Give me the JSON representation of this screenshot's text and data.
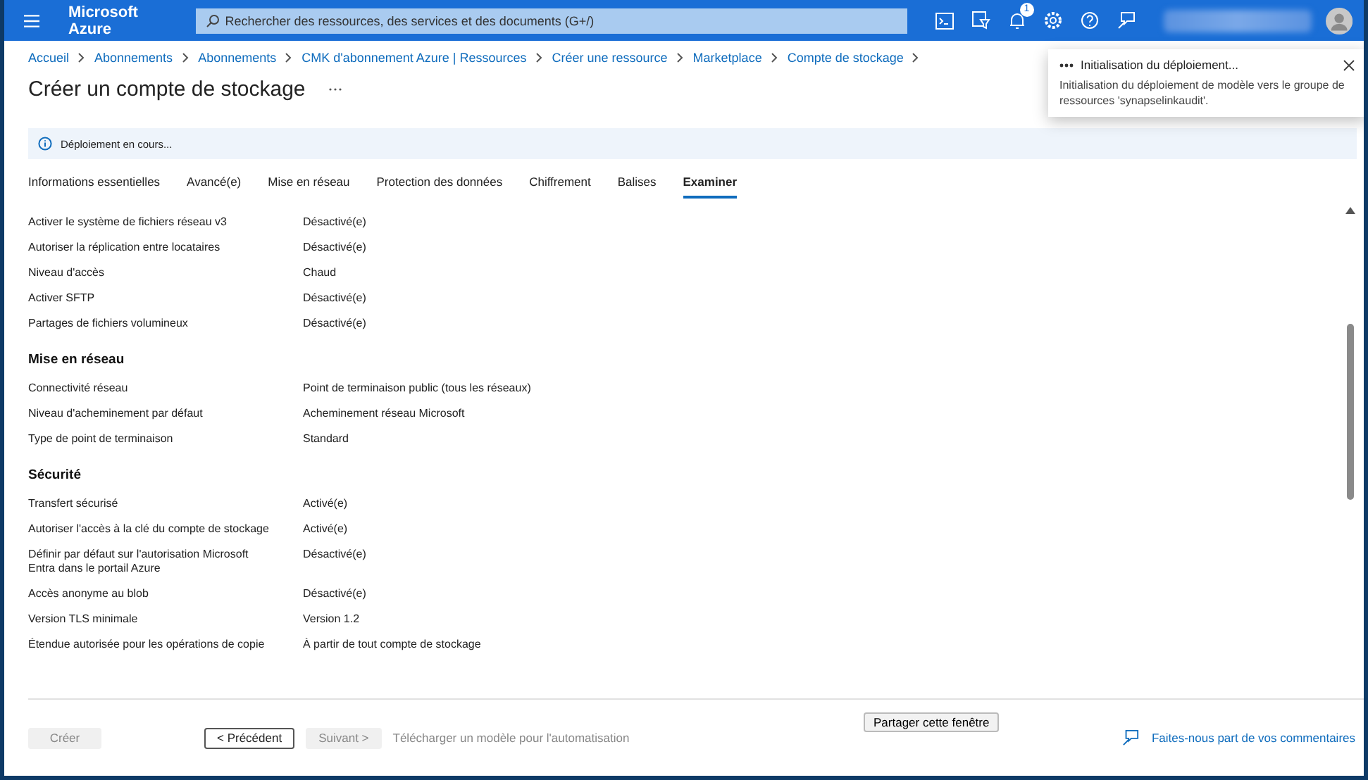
{
  "topbar": {
    "brand": "Microsoft Azure",
    "search": {
      "placeholder": "Rechercher des ressources, des services et des documents (G+/)"
    },
    "notification_count": "1"
  },
  "breadcrumb": [
    "Accueil",
    "Abonnements",
    "Abonnements",
    "CMK d'abonnement Azure | Ressources",
    "Créer une ressource",
    "Marketplace",
    "Compte de stockage"
  ],
  "page": {
    "title": "Créer un compte de stockage"
  },
  "banner": {
    "text": "Déploiement en cours..."
  },
  "tabs": [
    {
      "label": "Informations essentielles",
      "selected": false
    },
    {
      "label": "Avancé(e)",
      "selected": false
    },
    {
      "label": "Mise en réseau",
      "selected": false
    },
    {
      "label": "Protection des données",
      "selected": false
    },
    {
      "label": "Chiffrement",
      "selected": false
    },
    {
      "label": "Balises",
      "selected": false
    },
    {
      "label": "Examiner",
      "selected": true
    }
  ],
  "sections": [
    {
      "rows": [
        {
          "label": "Activer le système de fichiers réseau v3",
          "value": "Désactivé(e)"
        },
        {
          "label": "Autoriser la réplication entre locataires",
          "value": "Désactivé(e)"
        },
        {
          "label": "Niveau d'accès",
          "value": "Chaud"
        },
        {
          "label": "Activer SFTP",
          "value": "Désactivé(e)"
        },
        {
          "label": "Partages de fichiers volumineux",
          "value": "Désactivé(e)"
        }
      ]
    },
    {
      "heading": "Mise en réseau",
      "rows": [
        {
          "label": "Connectivité réseau",
          "value": "Point de terminaison public (tous les réseaux)"
        },
        {
          "label": "Niveau d'acheminement par défaut",
          "value": "Acheminement réseau Microsoft"
        },
        {
          "label": "Type de point de terminaison",
          "value": "Standard"
        }
      ]
    },
    {
      "heading": "Sécurité",
      "rows": [
        {
          "label": "Transfert sécurisé",
          "value": "Activé(e)"
        },
        {
          "label": "Autoriser l'accès à la clé du compte de stockage",
          "value": "Activé(e)"
        },
        {
          "label": "Définir par défaut sur l'autorisation Microsoft Entra dans le portail Azure",
          "value": "Désactivé(e)"
        },
        {
          "label": "Accès anonyme au blob",
          "value": "Désactivé(e)"
        },
        {
          "label": "Version TLS minimale",
          "value": "Version 1.2"
        },
        {
          "label": "Étendue autorisée pour les opérations de copie",
          "value": "À partir de tout compte de stockage"
        }
      ]
    }
  ],
  "footer": {
    "buttons": [
      {
        "kind": "button",
        "label": "Créer",
        "disabled": true
      },
      {
        "kind": "button",
        "label": "< Précédent",
        "disabled": false
      },
      {
        "kind": "button",
        "label": "Suivant >",
        "disabled": true
      },
      {
        "kind": "link",
        "label": "Télécharger un modèle pour l'automatisation",
        "disabled": true
      }
    ],
    "share_button": "Partager cette fenêtre",
    "feedback": "Faites-nous part de vos commentaires"
  },
  "toast": {
    "title": "Initialisation du déploiement...",
    "message": "Initialisation du déploiement de modèle vers le groupe de ressources 'synapselinkaudit'."
  }
}
